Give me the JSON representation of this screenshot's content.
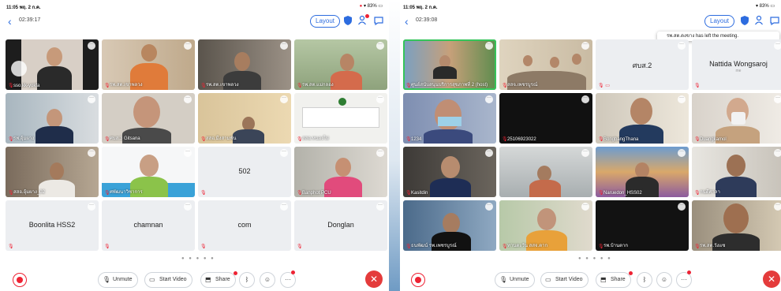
{
  "left": {
    "status_time": "11:05",
    "status_date": "พฤ. 2 ก.ค.",
    "status_battery": "83%",
    "clock": "02:39:17",
    "layout_label": "Layout",
    "tiles": [
      {
        "name": "sso.kk-yokfa",
        "center": ""
      },
      {
        "name": "รพ.สต.เขาพลวง",
        "center": ""
      },
      {
        "name": "รพ.สต.เขาพลวง",
        "center": ""
      },
      {
        "name": "รพ.สต.แม่กลอง",
        "center": ""
      },
      {
        "name": "รพ.อุ้มผาง",
        "center": ""
      },
      {
        "name": "ศบส.3 Gitsana",
        "center": ""
      },
      {
        "name": "สสอ.มีงสามพัน",
        "center": ""
      },
      {
        "name": "สสอ.หนองไผ่",
        "center": ""
      },
      {
        "name": "สสอ.อุ้มผาง_02",
        "center": ""
      },
      {
        "name": "ศพัฒนาวิชาการ",
        "center": ""
      },
      {
        "name": "",
        "center": "502"
      },
      {
        "name": "Banphot PCU",
        "center": ""
      },
      {
        "name": "",
        "center": "Boonlita HSS2"
      },
      {
        "name": "",
        "center": "chamnan"
      },
      {
        "name": "",
        "center": "com"
      },
      {
        "name": "",
        "center": "Donglan"
      }
    ],
    "toolbar": {
      "unmute": "Unmute",
      "start_video": "Start Video",
      "share": "Share"
    }
  },
  "right": {
    "status_time": "11:05",
    "status_date": "พฤ. 2 ก.ค.",
    "status_battery": "83%",
    "clock": "02:39:08",
    "layout_label": "Layout",
    "toast": "รพ.สต.ดงขาง has left the meeting.",
    "tiles": [
      {
        "name": "ศูนย์สนับสนุนบริการสุขภาพที่ 2 (host)",
        "center": "",
        "sub": ""
      },
      {
        "name": "สสจ.เพชรบูรณ์",
        "center": "",
        "sub": ""
      },
      {
        "name": "",
        "center": "ศบส.2",
        "sub": ""
      },
      {
        "name": "",
        "center": "Nattida Wongsaroj",
        "sub": "me"
      },
      {
        "name": "1234",
        "center": "",
        "sub": ""
      },
      {
        "name": "25106923022",
        "center": "",
        "sub": ""
      },
      {
        "name": "BongbangThana",
        "center": "",
        "sub": ""
      },
      {
        "name": "Duangkamol",
        "center": "",
        "sub": ""
      },
      {
        "name": "Kasitdin",
        "center": "",
        "sub": ""
      },
      {
        "name": "",
        "center": "",
        "sub": ""
      },
      {
        "name": "Naruedon_HSS02",
        "center": "",
        "sub": ""
      },
      {
        "name": "กนดีศาลา",
        "center": "",
        "sub": ""
      },
      {
        "name": "ธนพัฒน์ รพ.เพชรบูรณ์",
        "center": "",
        "sub": ""
      },
      {
        "name": "ทานตะวัน สสจ.ตาก",
        "center": "",
        "sub": ""
      },
      {
        "name": "รพ.บ้านตาก",
        "center": "",
        "sub": ""
      },
      {
        "name": "รพ.สต.วังแซ",
        "center": "",
        "sub": ""
      }
    ],
    "toolbar": {
      "unmute": "Unmute",
      "start_video": "Start Video",
      "share": "Share"
    }
  }
}
